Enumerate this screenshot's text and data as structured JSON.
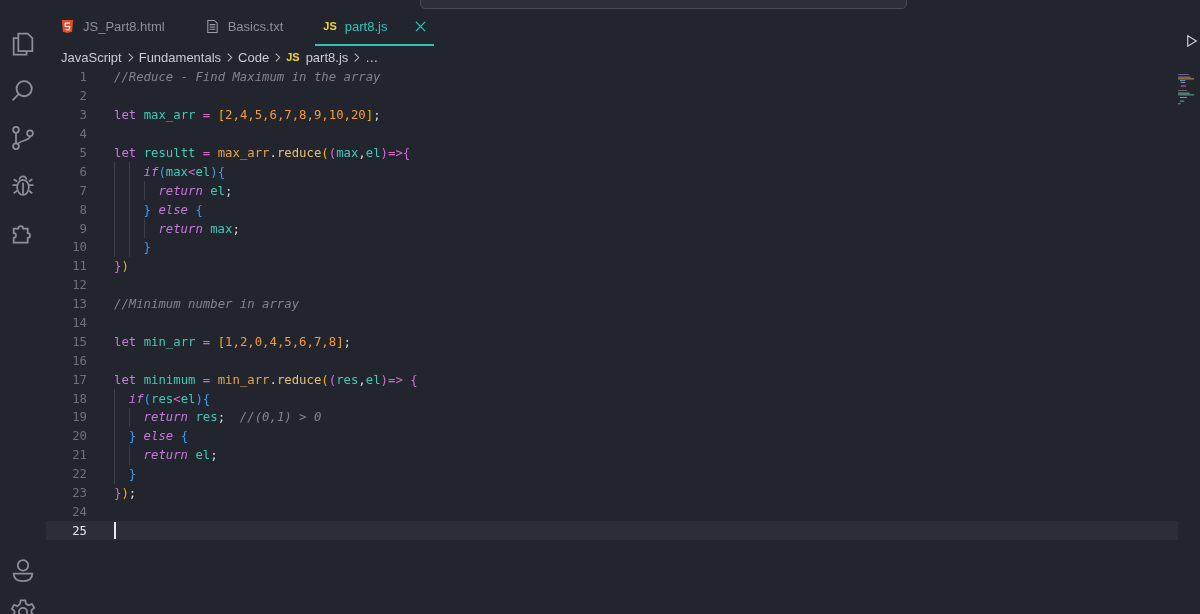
{
  "tabs": [
    {
      "label": "JS_Part8.html",
      "kind": "html",
      "selected": false
    },
    {
      "label": "Basics.txt",
      "kind": "text",
      "selected": false
    },
    {
      "label": "part8.js",
      "kind": "script",
      "badge": "JS",
      "selected": true
    }
  ],
  "breadcrumb": [
    {
      "label": "JavaScript"
    },
    {
      "label": "Fundamentals"
    },
    {
      "label": "Code"
    },
    {
      "label": "part8.js",
      "badge": "JS"
    },
    {
      "label": "…"
    }
  ],
  "lines": [
    {
      "number": "1",
      "current": false,
      "tokens": [
        {
          "kind": "comment",
          "text": "//Reduce - Find Maximum in the array"
        }
      ]
    },
    {
      "number": "2",
      "current": false
    },
    {
      "number": "3",
      "current": false,
      "tokens": [
        {
          "kind": "kw",
          "text": "let "
        },
        {
          "kind": "var",
          "text": "max_arr "
        },
        {
          "kind": "op",
          "text": "= "
        },
        {
          "kind": "br1",
          "text": "["
        },
        {
          "kind": "num",
          "text": "2,4,5,6,7,8,9,10,20"
        },
        {
          "kind": "br1",
          "text": "]"
        },
        {
          "kind": "plain",
          "text": ";"
        }
      ]
    },
    {
      "number": "4",
      "current": false
    },
    {
      "number": "5",
      "current": false,
      "tokens": [
        {
          "kind": "kw",
          "text": "let "
        },
        {
          "kind": "var",
          "text": "resultt "
        },
        {
          "kind": "op",
          "text": "= "
        },
        {
          "kind": "obj",
          "text": "max_arr"
        },
        {
          "kind": "plain",
          "text": "."
        },
        {
          "kind": "fn",
          "text": "reduce"
        },
        {
          "kind": "br1",
          "text": "("
        },
        {
          "kind": "br2",
          "text": "("
        },
        {
          "kind": "var",
          "text": "max"
        },
        {
          "kind": "plain",
          "text": ","
        },
        {
          "kind": "var",
          "text": "el"
        },
        {
          "kind": "br2",
          "text": ")"
        },
        {
          "kind": "op",
          "text": "=>"
        },
        {
          "kind": "br2",
          "text": "{"
        }
      ]
    },
    {
      "number": "6",
      "current": false,
      "tokens": [
        {
          "kind": "indent"
        },
        {
          "kind": "indent"
        },
        {
          "kind": "ret",
          "text": "if"
        },
        {
          "kind": "br3",
          "text": "("
        },
        {
          "kind": "var",
          "text": "max"
        },
        {
          "kind": "op",
          "text": "<"
        },
        {
          "kind": "var",
          "text": "el"
        },
        {
          "kind": "br3",
          "text": ")"
        },
        {
          "kind": "br3",
          "text": "{"
        }
      ]
    },
    {
      "number": "7",
      "current": false,
      "tokens": [
        {
          "kind": "indent"
        },
        {
          "kind": "indent"
        },
        {
          "kind": "indent"
        },
        {
          "kind": "ret",
          "text": "return "
        },
        {
          "kind": "var",
          "text": "el"
        },
        {
          "kind": "plain",
          "text": ";"
        }
      ]
    },
    {
      "number": "8",
      "current": false,
      "tokens": [
        {
          "kind": "indent"
        },
        {
          "kind": "indent"
        },
        {
          "kind": "br3",
          "text": "} "
        },
        {
          "kind": "ret",
          "text": "else "
        },
        {
          "kind": "br3",
          "text": "{"
        }
      ]
    },
    {
      "number": "9",
      "current": false,
      "tokens": [
        {
          "kind": "indent"
        },
        {
          "kind": "indent"
        },
        {
          "kind": "indent"
        },
        {
          "kind": "ret",
          "text": "return "
        },
        {
          "kind": "var",
          "text": "max"
        },
        {
          "kind": "plain",
          "text": ";"
        }
      ]
    },
    {
      "number": "10",
      "current": false,
      "tokens": [
        {
          "kind": "indent"
        },
        {
          "kind": "indent"
        },
        {
          "kind": "br3",
          "text": "}"
        }
      ]
    },
    {
      "number": "11",
      "current": false,
      "tokens": [
        {
          "kind": "br2",
          "text": "}"
        },
        {
          "kind": "br1",
          "text": ")"
        }
      ]
    },
    {
      "number": "12",
      "current": false
    },
    {
      "number": "13",
      "current": false,
      "tokens": [
        {
          "kind": "comment",
          "text": "//Minimum number in array"
        }
      ]
    },
    {
      "number": "14",
      "current": false
    },
    {
      "number": "15",
      "current": false,
      "tokens": [
        {
          "kind": "kw",
          "text": "let "
        },
        {
          "kind": "var",
          "text": "min_arr "
        },
        {
          "kind": "op",
          "text": "= "
        },
        {
          "kind": "br1",
          "text": "["
        },
        {
          "kind": "num",
          "text": "1,2,0,4,5,6,7,8"
        },
        {
          "kind": "br1",
          "text": "]"
        },
        {
          "kind": "plain",
          "text": ";"
        }
      ]
    },
    {
      "number": "16",
      "current": false
    },
    {
      "number": "17",
      "current": false,
      "tokens": [
        {
          "kind": "kw",
          "text": "let "
        },
        {
          "kind": "var",
          "text": "minimum "
        },
        {
          "kind": "op",
          "text": "= "
        },
        {
          "kind": "obj",
          "text": "min_arr"
        },
        {
          "kind": "plain",
          "text": "."
        },
        {
          "kind": "fn",
          "text": "reduce"
        },
        {
          "kind": "br1",
          "text": "("
        },
        {
          "kind": "br2",
          "text": "("
        },
        {
          "kind": "var",
          "text": "res"
        },
        {
          "kind": "plain",
          "text": ","
        },
        {
          "kind": "var",
          "text": "el"
        },
        {
          "kind": "br2",
          "text": ")"
        },
        {
          "kind": "op",
          "text": "=> "
        },
        {
          "kind": "br2",
          "text": "{"
        }
      ]
    },
    {
      "number": "18",
      "current": false,
      "tokens": [
        {
          "kind": "indent"
        },
        {
          "kind": "ret",
          "text": "if"
        },
        {
          "kind": "br3",
          "text": "("
        },
        {
          "kind": "var",
          "text": "res"
        },
        {
          "kind": "op",
          "text": "<"
        },
        {
          "kind": "var",
          "text": "el"
        },
        {
          "kind": "br3",
          "text": ")"
        },
        {
          "kind": "br3",
          "text": "{"
        }
      ]
    },
    {
      "number": "19",
      "current": false,
      "tokens": [
        {
          "kind": "indent"
        },
        {
          "kind": "indent"
        },
        {
          "kind": "ret",
          "text": "return "
        },
        {
          "kind": "var",
          "text": "res"
        },
        {
          "kind": "plain",
          "text": ";  "
        },
        {
          "kind": "comment",
          "text": "//(0,1) > 0"
        }
      ]
    },
    {
      "number": "20",
      "current": false,
      "tokens": [
        {
          "kind": "indent"
        },
        {
          "kind": "br3",
          "text": "} "
        },
        {
          "kind": "ret",
          "text": "else "
        },
        {
          "kind": "br3",
          "text": "{"
        }
      ]
    },
    {
      "number": "21",
      "current": false,
      "tokens": [
        {
          "kind": "indent"
        },
        {
          "kind": "indent"
        },
        {
          "kind": "ret",
          "text": "return "
        },
        {
          "kind": "var",
          "text": "el"
        },
        {
          "kind": "plain",
          "text": ";"
        }
      ]
    },
    {
      "number": "22",
      "current": false,
      "tokens": [
        {
          "kind": "indent"
        },
        {
          "kind": "br3",
          "text": "}"
        }
      ]
    },
    {
      "number": "23",
      "current": false,
      "tokens": [
        {
          "kind": "br2",
          "text": "}"
        },
        {
          "kind": "br1",
          "text": ")"
        },
        {
          "kind": "plain",
          "text": ";"
        }
      ]
    },
    {
      "number": "24",
      "current": false
    },
    {
      "number": "25",
      "current": true
    }
  ]
}
